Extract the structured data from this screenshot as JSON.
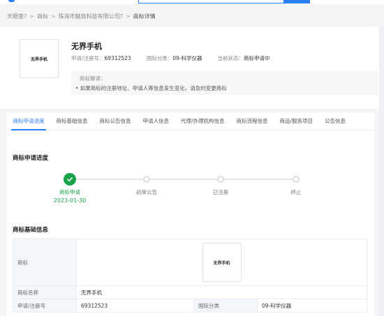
{
  "breadcrumb": {
    "items": [
      "天眼查?",
      "商标",
      "珠海市魅族科技有限公司?",
      "商标详情"
    ]
  },
  "trademark": {
    "logo_text": "无界手机",
    "name": "无界手机",
    "reg_no_label": "申请/注册号：",
    "reg_no": "69312523",
    "class_label": "国际分类：",
    "class": "09-科学仪器",
    "status_label": "当前状态：",
    "status": "商标申请中"
  },
  "notice": {
    "title": "商标解读：",
    "body": "• 如果商标的注册地址、申请人等信息发生变化，请及时变更商标"
  },
  "tabs": [
    "商标申请进度",
    "商标基础信息",
    "商标公告信息",
    "申请人信息",
    "代理/办理机构信息",
    "商标流程信息",
    "商品/服务项目",
    "公告信息"
  ],
  "progress": {
    "title": "商标申请进度",
    "steps": [
      {
        "label": "商标申请",
        "date": "2023-01-30",
        "done": true
      },
      {
        "label": "初审公告",
        "date": "",
        "done": false
      },
      {
        "label": "已注册",
        "date": "",
        "done": false
      },
      {
        "label": "终止",
        "date": "",
        "done": false
      }
    ]
  },
  "basic": {
    "title": "商标基础信息",
    "logo_label": "商标",
    "logo_text": "无界手机",
    "name_label": "商标名称",
    "name": "无界手机",
    "reg_label": "申请/注册号",
    "reg": "69312523",
    "class_label": "国际分类",
    "class": "09-科学仪器"
  },
  "colors": {
    "accent": "#2a7fff",
    "success": "#1aa34a"
  }
}
